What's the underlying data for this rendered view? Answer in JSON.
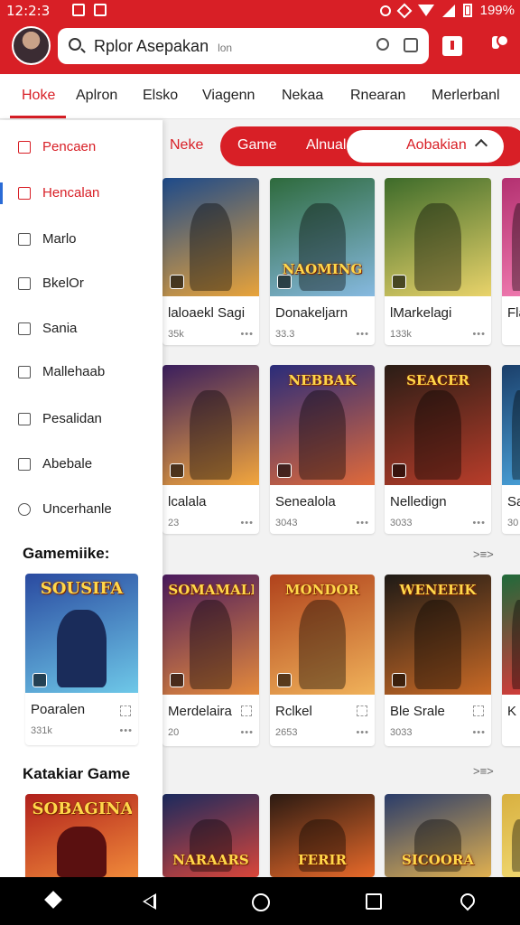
{
  "status": {
    "time": "12:2:3",
    "battery": "199%"
  },
  "search": {
    "text": "Rplor Asepakan",
    "hint": "lon"
  },
  "tabs": [
    "Hoke",
    "Aplron",
    "Elsko",
    "Viagenn",
    "Nekaa",
    "Rnearan",
    "Merlerbanl"
  ],
  "sidebar": {
    "items": [
      {
        "label": "Pencaen",
        "icon": "square-outline-icon"
      },
      {
        "label": "Hencalan",
        "icon": "square-filled-icon"
      },
      {
        "label": "Marlo",
        "icon": "square-outline-icon"
      },
      {
        "label": "BkelOr",
        "icon": "square-dot-icon"
      },
      {
        "label": "Sania",
        "icon": "square-dot-icon"
      },
      {
        "label": "Mallehaab",
        "icon": "square-slash-icon"
      },
      {
        "label": "Pesalidan",
        "icon": "note-icon"
      },
      {
        "label": "Abebale",
        "icon": "square-outline-icon"
      },
      {
        "label": "Uncerhanle",
        "icon": "gear-icon"
      }
    ],
    "section1": "Gamemiike:",
    "section2": "Katakiar Game",
    "card1": {
      "banner": "SOUSIFA",
      "title": "Poaralen",
      "sub": "331k"
    }
  },
  "filters": {
    "link": "Neke",
    "pills": [
      "Game",
      "Alnual"
    ],
    "selected": "Aobakian"
  },
  "rows": [
    [
      {
        "banner": "",
        "title": "laloaekl Sagi",
        "sub": "35k",
        "bg1": "#1d4a8a",
        "bg2": "#e8a33a"
      },
      {
        "banner": "NAOMING",
        "title": "Donakeljarn",
        "sub": "33.3",
        "bg1": "#2e6a3c",
        "bg2": "#86b9e0"
      },
      {
        "banner": "",
        "title": "lMarkelagi",
        "sub": "133k",
        "bg1": "#3d6b2a",
        "bg2": "#e9d36a"
      },
      {
        "banner": "",
        "title": "Fla",
        "sub": "",
        "bg1": "#b33070",
        "bg2": "#f07bb0"
      }
    ],
    [
      {
        "banner": "",
        "title": "lcalala",
        "sub": "23",
        "bg1": "#3a1e5e",
        "bg2": "#f2a63d"
      },
      {
        "banner": "NEBBAK",
        "title": "Senealola",
        "sub": "3043",
        "bg1": "#2a2c7a",
        "bg2": "#e06a3a"
      },
      {
        "banner": "SEACER",
        "title": "Nelledign",
        "sub": "3033",
        "bg1": "#2a1d16",
        "bg2": "#b83d2a"
      },
      {
        "banner": "",
        "title": "Sa",
        "sub": "30",
        "bg1": "#1b3f6a",
        "bg2": "#48a0d8"
      }
    ],
    [
      {
        "banner": "SOMAMALE",
        "title": "Merdelaira",
        "sub": "20",
        "bg1": "#4a1a5e",
        "bg2": "#e48a3c"
      },
      {
        "banner": "MONDOR",
        "title": "Rclkel",
        "sub": "2653",
        "bg1": "#b0421c",
        "bg2": "#f0b25a"
      },
      {
        "banner": "WENEEIK",
        "title": "Ble Srale",
        "sub": "3033",
        "bg1": "#1e1a16",
        "bg2": "#c96a26"
      },
      {
        "banner": "",
        "title": "K",
        "sub": "",
        "bg1": "#1f6a3a",
        "bg2": "#d83a3a"
      }
    ],
    [
      {
        "banner": "NARAARS",
        "title": "",
        "sub": "",
        "bg1": "#1b2a5e",
        "bg2": "#d9463a"
      },
      {
        "banner": "FERIR",
        "title": "",
        "sub": "",
        "bg1": "#2b1a12",
        "bg2": "#e86a2a"
      },
      {
        "banner": "SICOORA",
        "title": "",
        "sub": "",
        "bg1": "#2a3c6a",
        "bg2": "#e0b050"
      },
      {
        "banner": "",
        "title": "",
        "sub": "",
        "bg1": "#d8b040",
        "bg2": "#f0d870"
      }
    ]
  ],
  "more1": ">≡>",
  "more2": ">≡>",
  "row4_sidebar_banner": "SOBAGINA"
}
